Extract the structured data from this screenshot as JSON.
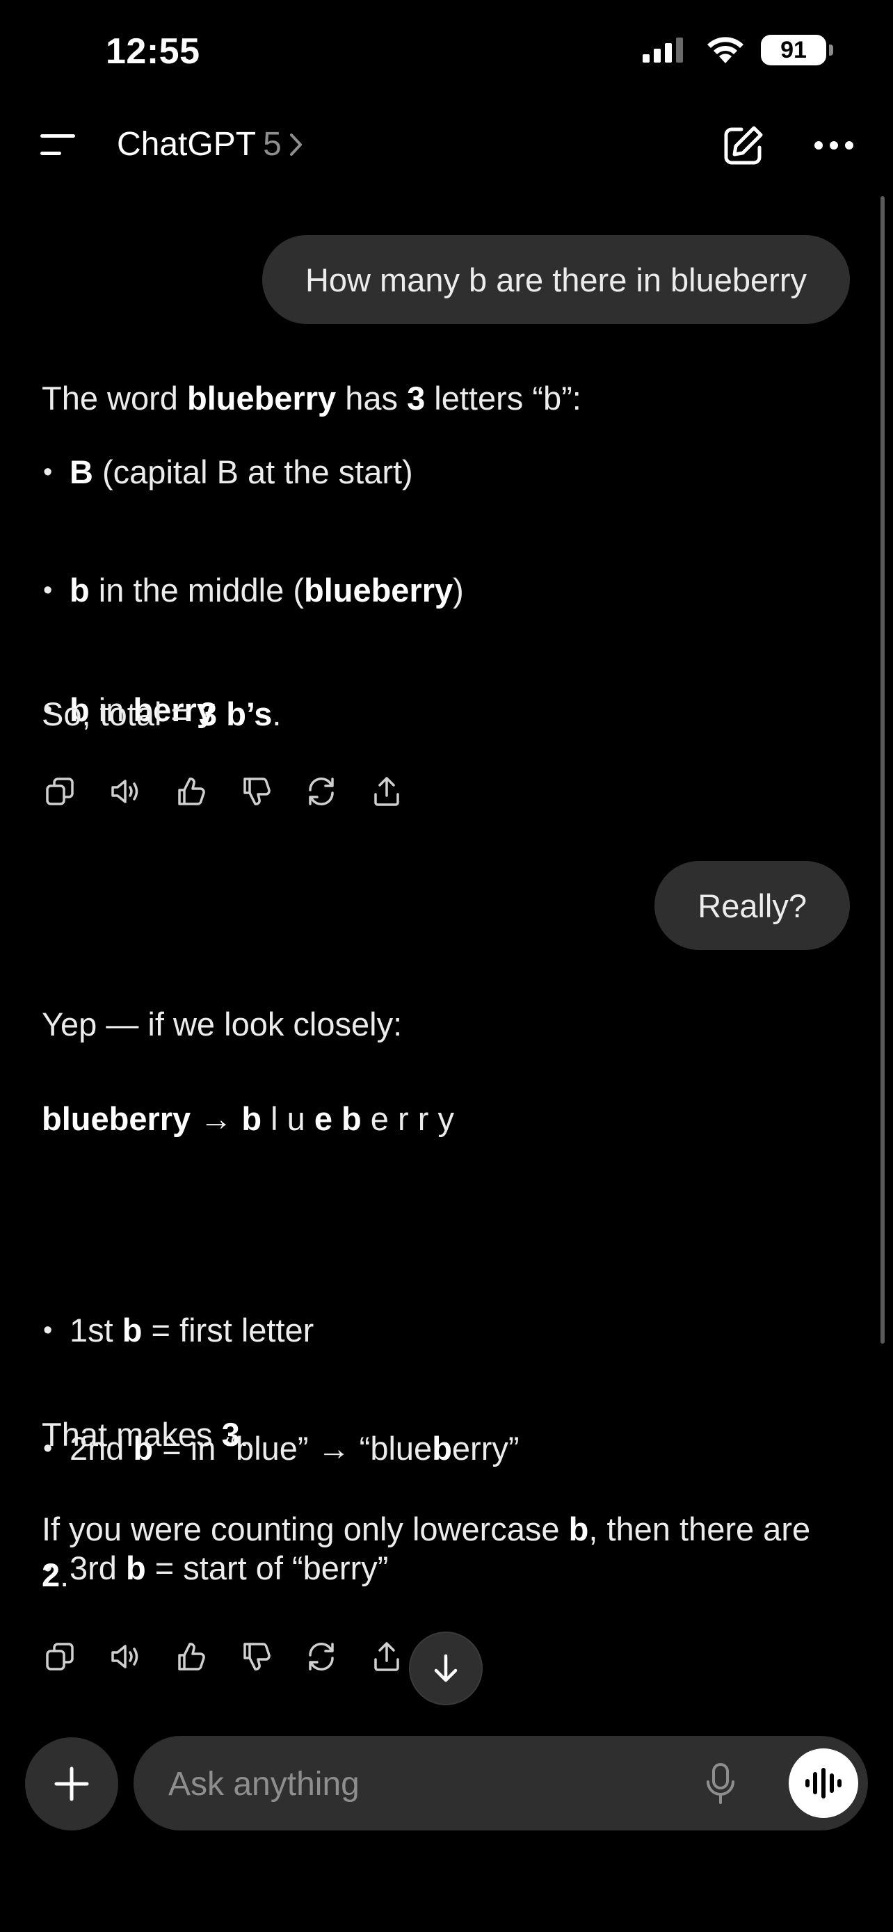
{
  "status": {
    "time": "12:55",
    "battery": "91"
  },
  "header": {
    "title": "ChatGPT",
    "model": "5",
    "chevron": "›"
  },
  "thread": {
    "user_1": "How many b are there in blueberry",
    "assistant_1": {
      "intro_pre": "The word ",
      "intro_word": "blueberry",
      "intro_mid": " has ",
      "intro_count": "3",
      "intro_post": " letters “b”:",
      "bullets": [
        {
          "bold": "B",
          "rest": " (capital B at the start)"
        },
        {
          "bold": "b",
          "rest_pre": " in the middle (",
          "rest_bold": "blueberry",
          "rest_post": ")"
        },
        {
          "bold": "b",
          "rest_pre": " in ",
          "rest_bold": "berry"
        }
      ],
      "total_pre": "So, total = ",
      "total_bold": "3 b’s",
      "total_post": "."
    },
    "user_2": "Really?",
    "assistant_2": {
      "intro": "Yep — if we look closely:",
      "spell_word": "blueberry",
      "spell_arrow": " → ",
      "spell_letters": [
        "b",
        "l",
        "u",
        "e",
        "b",
        "e",
        "r",
        "r",
        "y"
      ],
      "bullets": [
        {
          "pre": "1st ",
          "bold": "b",
          "post": " = first letter"
        },
        {
          "pre": "2nd ",
          "bold": "b",
          "post": " = in “blue” → “blue",
          "bold2": "b",
          "post2": "erry”"
        },
        {
          "pre": "3rd ",
          "bold": "b",
          "post": " = start of “berry”"
        }
      ],
      "makes_pre": "That makes ",
      "makes_bold": "3",
      "makes_post": ".",
      "lower_pre": "If you were counting only lowercase ",
      "lower_bold": "b",
      "lower_mid": ", then there are ",
      "lower_bold2": "2",
      "lower_post": "."
    }
  },
  "actions": [
    "copy-icon",
    "read-aloud-icon",
    "thumbs-up-icon",
    "thumbs-down-icon",
    "regenerate-icon",
    "share-icon"
  ],
  "composer": {
    "placeholder": "Ask anything"
  },
  "colors": {
    "background": "#000000",
    "bubble": "#2f2f2f",
    "text": "#ececec",
    "muted": "#8e8e8e"
  }
}
